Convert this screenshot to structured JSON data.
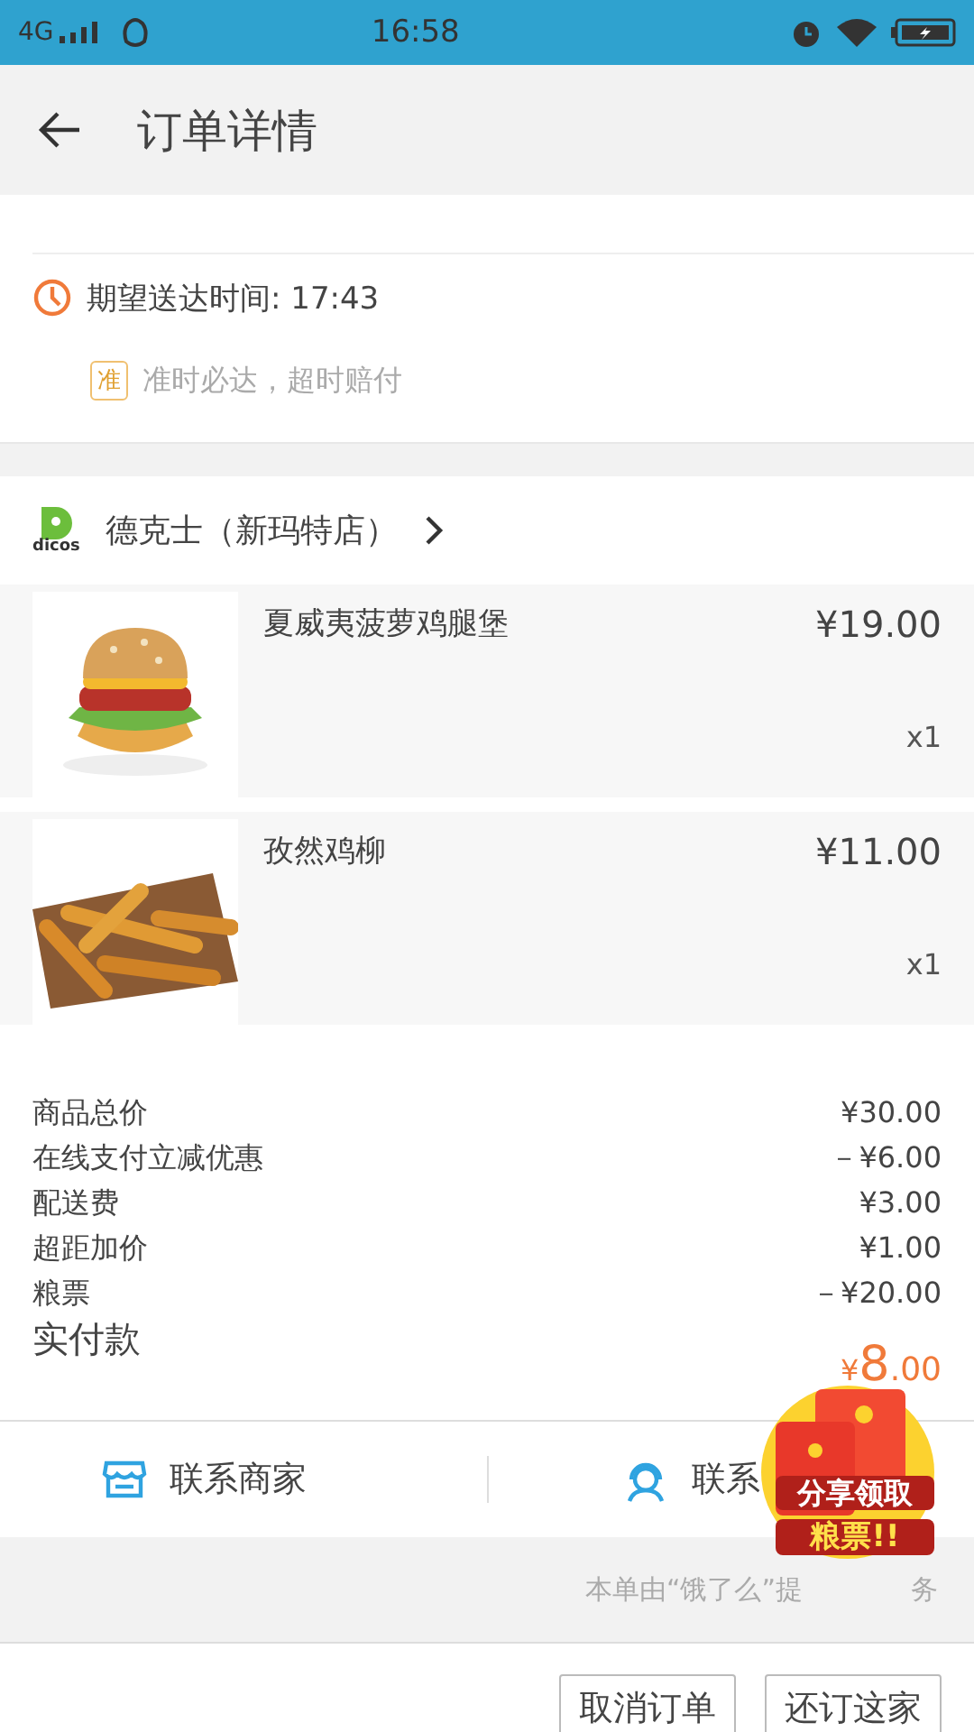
{
  "status_bar": {
    "network": "4G",
    "time": "16:58"
  },
  "header": {
    "title": "订单详情"
  },
  "delivery": {
    "expected": "期望送达时间: 17:43",
    "badge": "准",
    "promise": "准时必达，超时赔付"
  },
  "store": {
    "name": "德克士（新玛特店）",
    "logo_text": "dicos"
  },
  "items": [
    {
      "name": "夏威夷菠萝鸡腿堡",
      "price": "¥19.00",
      "qty": "x1",
      "kind": "burger"
    },
    {
      "name": "孜然鸡柳",
      "price": "¥11.00",
      "qty": "x1",
      "kind": "strips"
    }
  ],
  "summary": [
    {
      "label": "商品总价",
      "value": "¥30.00"
    },
    {
      "label": "在线支付立减优惠",
      "value": "－¥6.00"
    },
    {
      "label": "配送费",
      "value": "¥3.00"
    },
    {
      "label": "超距加价",
      "value": "¥1.00"
    },
    {
      "label": "粮票",
      "value": "－¥20.00"
    }
  ],
  "total": {
    "label": "实付款",
    "currency": "¥",
    "integer": "8",
    "decimals": ".00"
  },
  "contacts": [
    {
      "label": "联系商家",
      "kind": "store"
    },
    {
      "label": "联系",
      "kind": "rider"
    }
  ],
  "footer_note": {
    "before": "本单由“饿了么”提",
    "after": "务"
  },
  "promo_badge": {
    "line1": "分享领取",
    "line2": "粮票!!"
  },
  "actions": [
    "取消订单",
    "还订这家"
  ]
}
